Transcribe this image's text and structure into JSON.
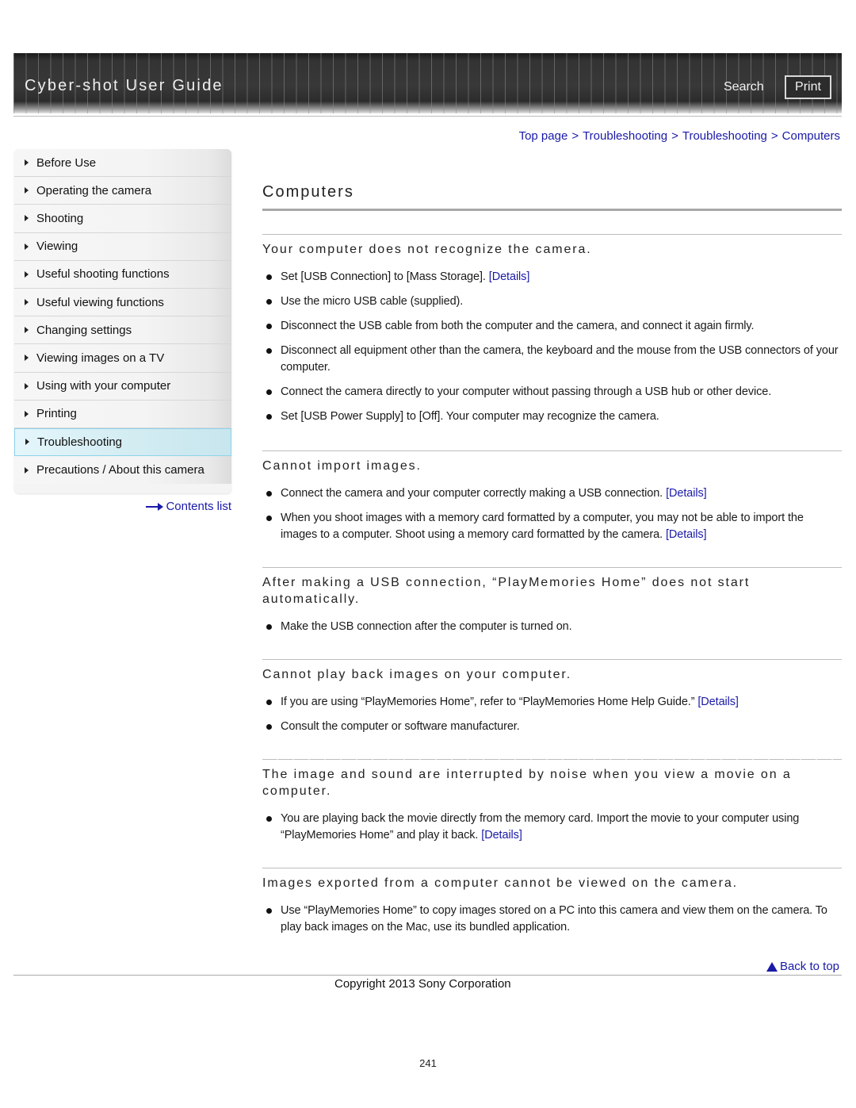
{
  "header": {
    "site_title": "Cyber-shot User Guide",
    "search_label": "Search",
    "print_label": "Print"
  },
  "breadcrumb": {
    "items": [
      "Top page",
      "Troubleshooting",
      "Troubleshooting",
      "Computers"
    ],
    "separator": ">"
  },
  "sidebar": {
    "items": [
      {
        "label": "Before Use"
      },
      {
        "label": "Operating the camera"
      },
      {
        "label": "Shooting"
      },
      {
        "label": "Viewing"
      },
      {
        "label": "Useful shooting functions"
      },
      {
        "label": "Useful viewing functions"
      },
      {
        "label": "Changing settings"
      },
      {
        "label": "Viewing images on a TV"
      },
      {
        "label": "Using with your computer"
      },
      {
        "label": "Printing"
      },
      {
        "label": "Troubleshooting",
        "active": true
      },
      {
        "label": "Precautions / About this camera"
      }
    ],
    "contents_list_label": "Contents list"
  },
  "main": {
    "title": "Computers",
    "details_label": "[Details]",
    "sections": [
      {
        "heading": "Your computer does not recognize the camera.",
        "bullets": [
          {
            "text": "Set [USB Connection] to [Mass Storage].",
            "has_details": true
          },
          {
            "text": "Use the micro USB cable (supplied).",
            "has_details": false
          },
          {
            "text": "Disconnect the USB cable from both the computer and the camera, and connect it again firmly.",
            "has_details": false
          },
          {
            "text": "Disconnect all equipment other than the camera, the keyboard and the mouse from the USB connectors of your computer.",
            "has_details": false
          },
          {
            "text": "Connect the camera directly to your computer without passing through a USB hub or other device.",
            "has_details": false
          },
          {
            "text": "Set [USB Power Supply] to [Off]. Your computer may recognize the camera.",
            "has_details": false
          }
        ]
      },
      {
        "heading": "Cannot import images.",
        "bullets": [
          {
            "text": "Connect the camera and your computer correctly making a USB connection.",
            "has_details": true
          },
          {
            "text": "When you shoot images with a memory card formatted by a computer, you may not be able to import the images to a computer. Shoot using a memory card formatted by the camera.",
            "has_details": true
          }
        ]
      },
      {
        "heading": "After making a USB connection, “PlayMemories Home” does not start automatically.",
        "bullets": [
          {
            "text": "Make the USB connection after the computer is turned on.",
            "has_details": false
          }
        ]
      },
      {
        "heading": "Cannot play back images on your computer.",
        "bullets": [
          {
            "text": "If you are using “PlayMemories Home”, refer to “PlayMemories Home Help Guide.”",
            "has_details": true
          },
          {
            "text": "Consult the computer or software manufacturer.",
            "has_details": false
          }
        ]
      },
      {
        "heading": "The image and sound are interrupted by noise when you view a movie on a computer.",
        "bullets": [
          {
            "text": "You are playing back the movie directly from the memory card. Import the movie to your computer using “PlayMemories Home” and play it back.",
            "has_details": true
          }
        ]
      },
      {
        "heading": "Images exported from a computer cannot be viewed on the camera.",
        "bullets": [
          {
            "text": "Use “PlayMemories Home” to copy images stored on a PC into this camera and view them on the camera. To play back images on the Mac, use its bundled application.",
            "has_details": false
          }
        ]
      }
    ]
  },
  "footer": {
    "back_to_top_label": "Back to top",
    "copyright": "Copyright 2013 Sony Corporation",
    "page_number": "241"
  },
  "colors": {
    "link": "#1a1aa8",
    "active_nav_bg": "#d4edf3",
    "active_nav_border": "#8fd3ea",
    "banner_bg": "#333333"
  }
}
